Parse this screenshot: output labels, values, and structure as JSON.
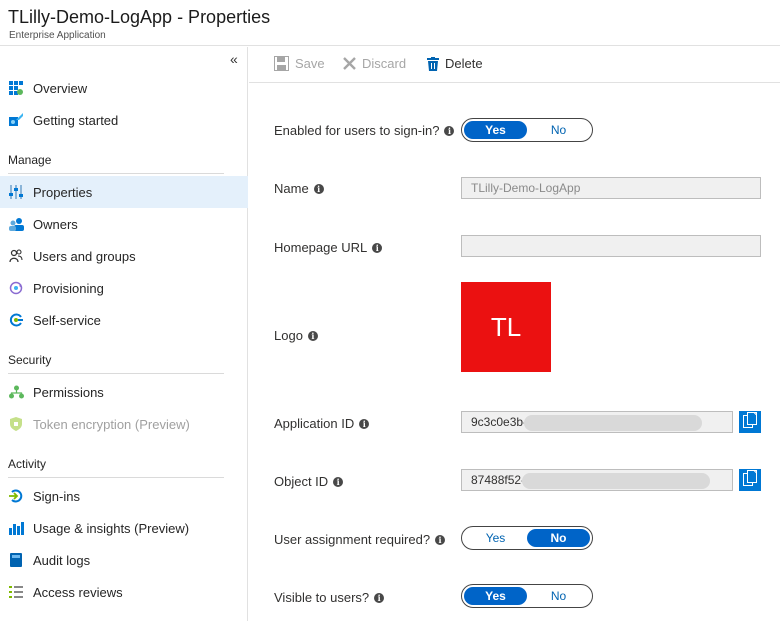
{
  "header": {
    "title": "TLilly-Demo-LogApp - Properties",
    "subtitle": "Enterprise Application"
  },
  "sidebar": {
    "collapse_glyph": "«",
    "items": [
      {
        "label": "Overview",
        "icon": "grid-icon"
      },
      {
        "label": "Getting started",
        "icon": "rocket-icon"
      },
      {
        "label": "Properties",
        "icon": "sliders-icon"
      },
      {
        "label": "Owners",
        "icon": "owners-icon"
      },
      {
        "label": "Users and groups",
        "icon": "users-icon"
      },
      {
        "label": "Provisioning",
        "icon": "provisioning-icon"
      },
      {
        "label": "Self-service",
        "icon": "self-service-icon"
      },
      {
        "label": "Permissions",
        "icon": "permissions-icon"
      },
      {
        "label": "Token encryption (Preview)",
        "icon": "shield-icon"
      },
      {
        "label": "Sign-ins",
        "icon": "sign-ins-icon"
      },
      {
        "label": "Usage & insights (Preview)",
        "icon": "chart-icon"
      },
      {
        "label": "Audit logs",
        "icon": "book-icon"
      },
      {
        "label": "Access reviews",
        "icon": "list-icon"
      }
    ],
    "sections": {
      "manage": "Manage",
      "security": "Security",
      "activity": "Activity"
    }
  },
  "toolbar": {
    "save_label": "Save",
    "discard_label": "Discard",
    "delete_label": "Delete"
  },
  "form": {
    "enabled_label": "Enabled for users to sign-in?",
    "name_label": "Name",
    "name_value": "TLilly-Demo-LogApp",
    "homepage_label": "Homepage URL",
    "homepage_value": "",
    "logo_label": "Logo",
    "logo_text": "TL",
    "app_id_label": "Application ID",
    "app_id_value": "9c3c0e3b-",
    "object_id_label": "Object ID",
    "object_id_value": "87488f52-",
    "assignment_label": "User assignment required?",
    "visible_label": "Visible to users?",
    "yes": "Yes",
    "no": "No"
  },
  "colors": {
    "accent": "#0064c8",
    "copy_button": "#0078d4",
    "logo_bg": "#eb1111",
    "active_nav": "#e4f0fb"
  }
}
